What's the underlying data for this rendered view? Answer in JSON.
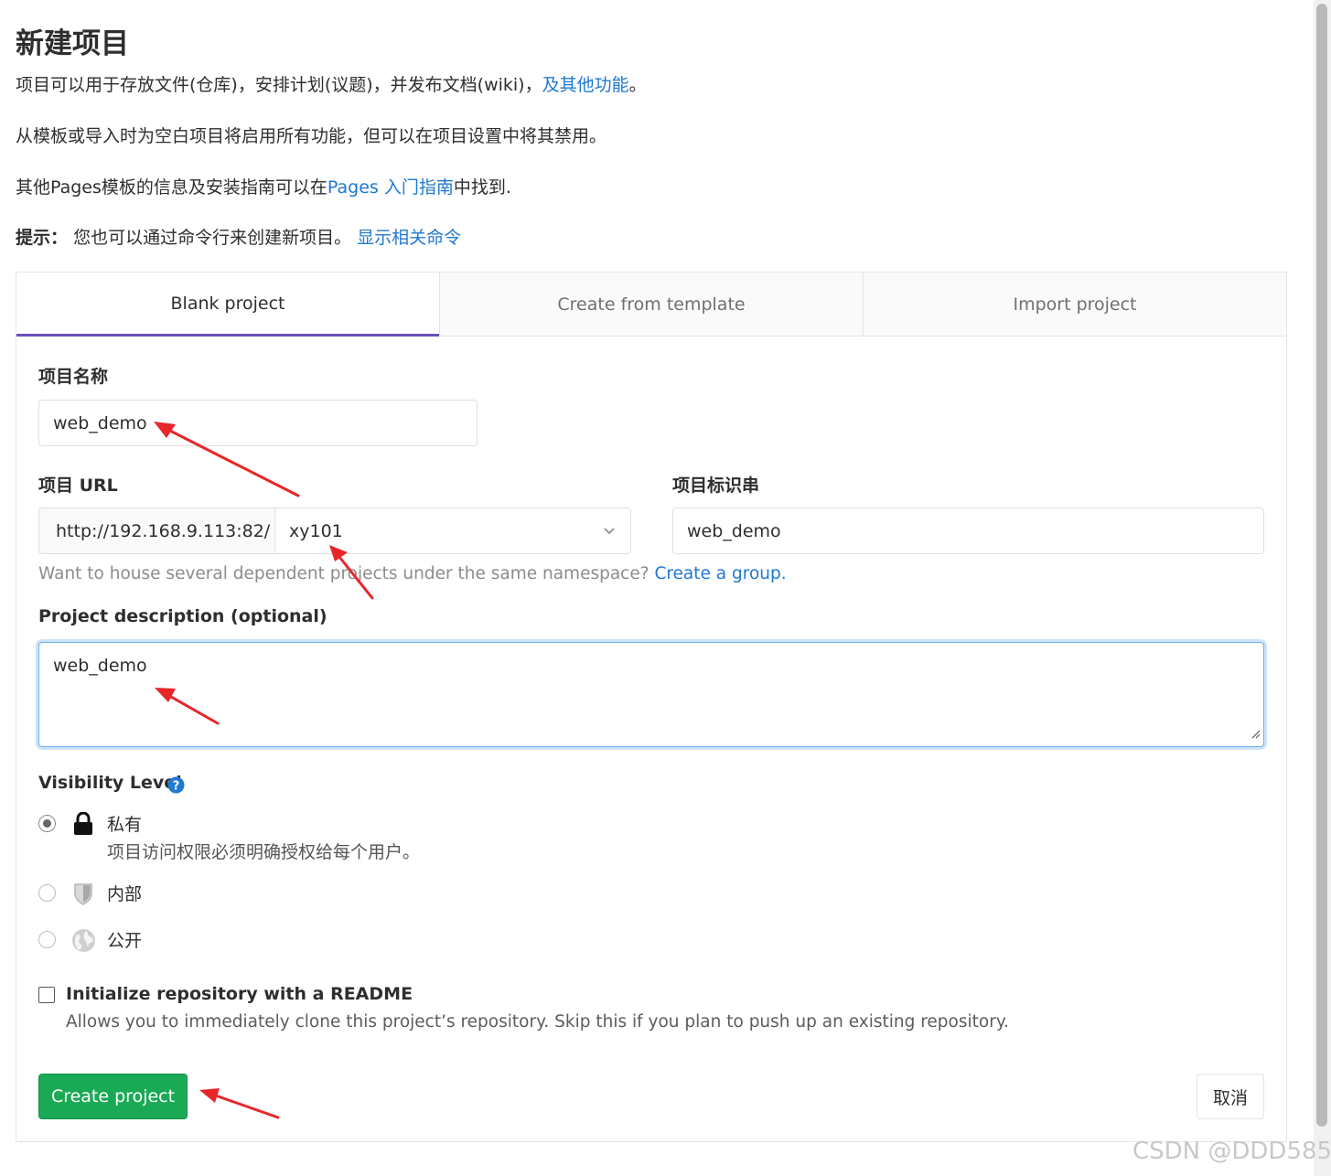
{
  "page": {
    "title": "新建项目",
    "intro1": "项目可以用于存放文件(仓库)，安排计划(议题)，并发布文档(wiki)，",
    "intro1_link": "及其他功能",
    "intro1_end": "。",
    "intro2": "从模板或导入时为空白项目将启用所有功能，但可以在项目设置中将其禁用。",
    "intro3_pre": "其他Pages模板的信息及安装指南可以在",
    "intro3_link": "Pages 入门指南",
    "intro3_post": "中找到.",
    "tip_label": "提示：",
    "tip_text": "您也可以通过命令行来创建新项目。",
    "tip_link": "显示相关命令"
  },
  "tabs": [
    {
      "label": "Blank project",
      "active": true
    },
    {
      "label": "Create from template",
      "active": false
    },
    {
      "label": "Import project",
      "active": false
    }
  ],
  "form": {
    "name_label": "项目名称",
    "name_value": "web_demo",
    "url_label": "项目 URL",
    "url_prefix": "http://192.168.9.113:82/",
    "namespace_value": "xy101",
    "slug_label": "项目标识串",
    "slug_value": "web_demo",
    "group_help": "Want to house several dependent projects under the same namespace?",
    "group_link": "Create a group.",
    "desc_label": "Project description (optional)",
    "desc_value": "web_demo",
    "visibility_label": "Visibility Level",
    "visibility_options": [
      {
        "label": "私有",
        "desc": "项目访问权限必须明确授权给每个用户。",
        "icon": "lock-icon",
        "checked": true
      },
      {
        "label": "内部",
        "desc": "",
        "icon": "shield-icon",
        "checked": false
      },
      {
        "label": "公开",
        "desc": "",
        "icon": "globe-icon",
        "checked": false
      }
    ],
    "readme_label": "Initialize repository with a README",
    "readme_desc": "Allows you to immediately clone this project’s repository. Skip this if you plan to push up an existing repository.",
    "readme_checked": false,
    "create_button": "Create project",
    "cancel_button": "取消"
  },
  "watermark": "CSDN @DDD585",
  "colors": {
    "link": "#1f78d1",
    "primary_button": "#1aaa55",
    "active_tab_border": "#6b4fbb",
    "annotation_arrow": "#e8262a"
  }
}
